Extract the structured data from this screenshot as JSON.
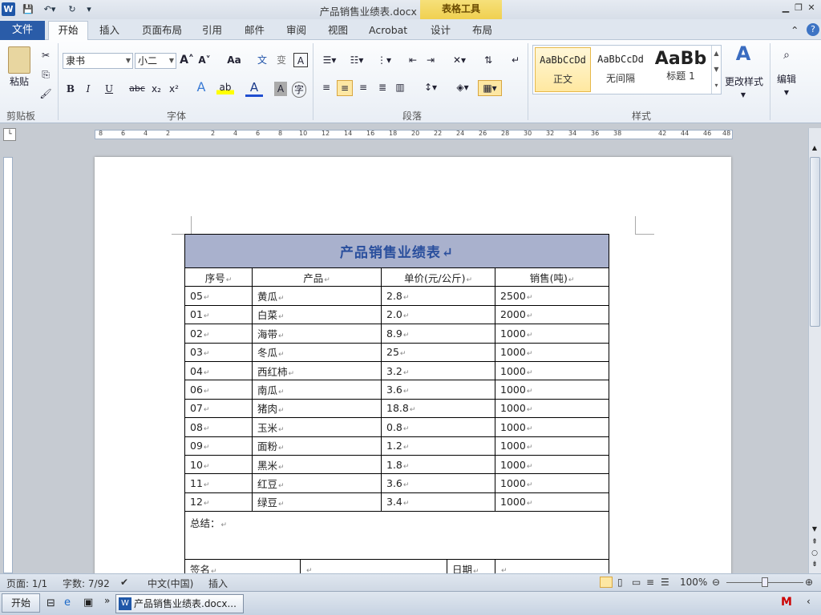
{
  "window": {
    "title": "产品销售业绩表.docx - Microsoft Word",
    "table_tools": "表格工具",
    "app_letter": "W"
  },
  "tabs": [
    "文件",
    "开始",
    "插入",
    "页面布局",
    "引用",
    "邮件",
    "审阅",
    "视图",
    "Acrobat",
    "设计",
    "布局"
  ],
  "ribbon": {
    "clipboard": {
      "paste": "粘贴",
      "group": "剪贴板"
    },
    "font": {
      "name": "隶书",
      "size": "小二",
      "grow": "A",
      "shrink": "A",
      "case": "Aa",
      "bold": "B",
      "italic": "I",
      "underline": "U",
      "strike": "abc",
      "sub": "x₂",
      "sup": "x²",
      "group": "字体"
    },
    "paragraph": {
      "group": "段落"
    },
    "styles": {
      "items": [
        {
          "sample": "AaBbCcDd",
          "name": "正文"
        },
        {
          "sample": "AaBbCcDd",
          "name": "无间隔"
        },
        {
          "sample": "AaBb",
          "name": "标题 1"
        }
      ],
      "change": "更改样式",
      "group": "样式"
    },
    "editing": {
      "label": "编辑"
    }
  },
  "ruler_numbers": [
    "8",
    "6",
    "4",
    "2",
    "2",
    "4",
    "6",
    "8",
    "10",
    "12",
    "14",
    "16",
    "18",
    "20",
    "22",
    "24",
    "26",
    "28",
    "30",
    "32",
    "34",
    "36",
    "38",
    "42",
    "44",
    "46",
    "48"
  ],
  "document": {
    "title": "产品销售业绩表",
    "headers": [
      "序号",
      "产品",
      "单价(元/公斤)",
      "销售(吨)"
    ],
    "rows": [
      [
        "05",
        "黄瓜",
        "2.8",
        "2500"
      ],
      [
        "01",
        "白菜",
        "2.0",
        "2000"
      ],
      [
        "02",
        "海带",
        "8.9",
        "1000"
      ],
      [
        "03",
        "冬瓜",
        "25",
        "1000"
      ],
      [
        "04",
        "西红柿",
        "3.2",
        "1000"
      ],
      [
        "06",
        "南瓜",
        "3.6",
        "1000"
      ],
      [
        "07",
        "猪肉",
        "18.8",
        "1000"
      ],
      [
        "08",
        "玉米",
        "0.8",
        "1000"
      ],
      [
        "09",
        "面粉",
        "1.2",
        "1000"
      ],
      [
        "10",
        "黑米",
        "1.8",
        "1000"
      ],
      [
        "11",
        "红豆",
        "3.6",
        "1000"
      ],
      [
        "12",
        "绿豆",
        "3.4",
        "1000"
      ]
    ],
    "summary_label": "总结：",
    "sign_label": "签名",
    "date_label": "日期"
  },
  "status": {
    "page": "页面: 1/1",
    "words": "字数: 7/92",
    "language": "中文(中国)",
    "mode": "插入",
    "zoom": "100%"
  },
  "taskbar": {
    "start": "开始",
    "task": "产品销售业绩表.docx..."
  }
}
